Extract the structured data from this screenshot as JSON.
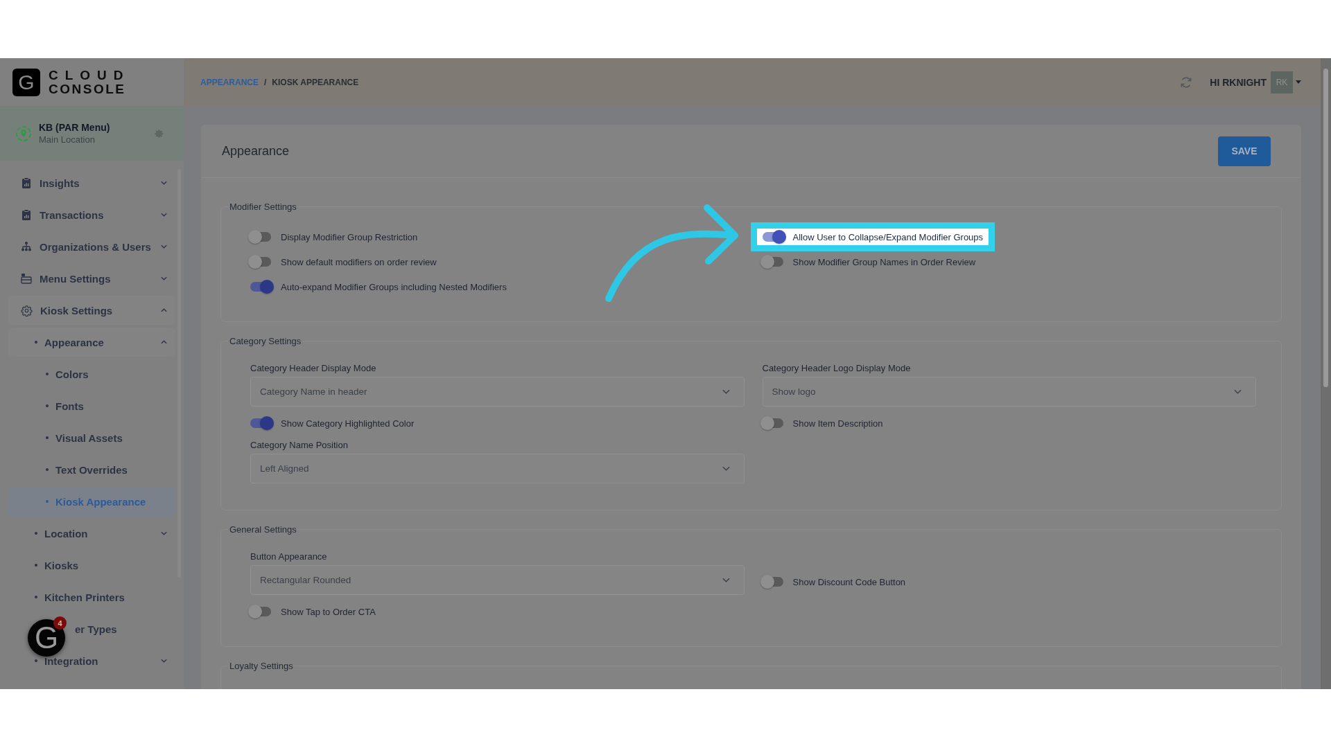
{
  "logo": {
    "mark": "G",
    "line1": "CLOUD",
    "line2": "CONSOLE"
  },
  "location": {
    "name": "KB (PAR Menu)",
    "detail": "Main Location"
  },
  "sidebar": {
    "items": [
      {
        "label": "Insights",
        "kind": "group",
        "expanded": false,
        "selected": false
      },
      {
        "label": "Transactions",
        "kind": "group",
        "expanded": false,
        "selected": false
      },
      {
        "label": "Organizations & Users",
        "kind": "group",
        "expanded": false,
        "selected": false
      },
      {
        "label": "Menu Settings",
        "kind": "group",
        "expanded": false,
        "selected": false
      },
      {
        "label": "Kiosk Settings",
        "kind": "group",
        "expanded": true,
        "selected": false,
        "children": [
          {
            "label": "Appearance",
            "kind": "group",
            "expanded": true,
            "selected": false,
            "children": [
              {
                "label": "Colors",
                "kind": "link",
                "selected": false
              },
              {
                "label": "Fonts",
                "kind": "link",
                "selected": false
              },
              {
                "label": "Visual Assets",
                "kind": "link",
                "selected": false
              },
              {
                "label": "Text Overrides",
                "kind": "link",
                "selected": false
              },
              {
                "label": "Kiosk Appearance",
                "kind": "link",
                "selected": true
              }
            ]
          },
          {
            "label": "Location",
            "kind": "group",
            "expanded": false,
            "selected": false
          },
          {
            "label": "Kiosks",
            "kind": "link",
            "selected": false
          },
          {
            "label": "Kitchen Printers",
            "kind": "link",
            "selected": false
          },
          {
            "label": "er Types",
            "kind": "covered",
            "selected": false
          },
          {
            "label": "Integration",
            "kind": "group",
            "expanded": false,
            "selected": false
          }
        ]
      }
    ]
  },
  "help_button": {
    "mark": "G",
    "badge": "4"
  },
  "breadcrumb": {
    "separator": "/",
    "items": [
      {
        "label": "APPEARANCE",
        "kind": "link"
      },
      {
        "label": "KIOSK APPEARANCE",
        "kind": "current"
      }
    ]
  },
  "user": {
    "greeting": "HI RKNIGHT",
    "initials": "RK"
  },
  "page": {
    "title": "Appearance",
    "save": "SAVE"
  },
  "sections": [
    {
      "title": "Modifier Settings",
      "left": [
        {
          "kind": "toggle",
          "label": "Display Modifier Group Restriction",
          "on": false
        },
        {
          "kind": "toggle",
          "label": "Show default modifiers on order review",
          "on": false
        },
        {
          "kind": "toggle",
          "label": "Auto-expand Modifier Groups including Nested Modifiers",
          "on": true
        }
      ],
      "right": [
        {
          "kind": "toggle",
          "label": "Allow User to Collapse/Expand Modifier Groups",
          "on": true,
          "highlighted": true
        },
        {
          "kind": "toggle",
          "label": "Show Modifier Group Names in Order Review",
          "on": false,
          "highlighted": false
        }
      ]
    },
    {
      "title": "Category Settings",
      "left": [
        {
          "kind": "select",
          "label": "Category Header Display Mode",
          "value": "Category Name in header"
        },
        {
          "kind": "toggle",
          "label": "Show Category Highlighted Color",
          "on": true
        },
        {
          "kind": "select",
          "label": "Category Name Position",
          "value": "Left Aligned"
        }
      ],
      "right": [
        {
          "kind": "select",
          "label": "Category Header Logo Display Mode",
          "value": "Show logo"
        },
        {
          "kind": "toggle",
          "label": "Show Item Description",
          "on": false
        }
      ]
    },
    {
      "title": "General Settings",
      "left": [
        {
          "kind": "select",
          "label": "Button Appearance",
          "value": "Rectangular Rounded"
        },
        {
          "kind": "toggle",
          "label": "Show Tap to Order CTA",
          "on": false
        }
      ],
      "right": [
        {
          "kind": "toggle",
          "label": "Show Discount Code Button",
          "on": false
        }
      ]
    },
    {
      "title": "Loyalty Settings"
    }
  ]
}
